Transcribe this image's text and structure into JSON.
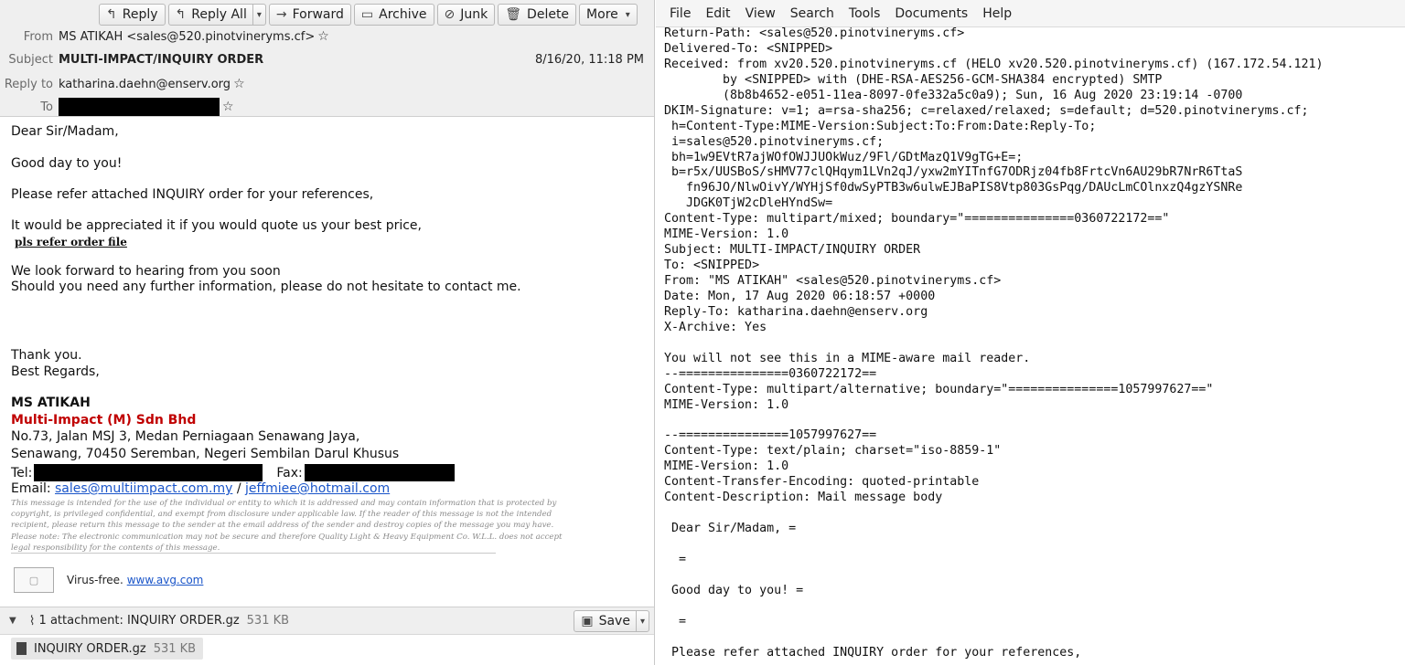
{
  "email": {
    "toolbar": {
      "reply": "Reply",
      "reply_all": "Reply All",
      "forward": "Forward",
      "archive": "Archive",
      "junk": "Junk",
      "delete": "Delete",
      "more": "More"
    },
    "header": {
      "from_label": "From",
      "from_value": "MS ATIKAH <sales@520.pinotvineryms.cf>",
      "subject_label": "Subject",
      "subject_value": "MULTI-IMPACT/INQUIRY ORDER",
      "date": "8/16/20, 11:18 PM",
      "replyto_label": "Reply to",
      "replyto_value": "katharina.daehn@enserv.org",
      "to_label": "To"
    },
    "body": {
      "greeting": "Dear Sir/Madam,",
      "line1": "Good day to you!",
      "line2": "Please refer attached INQUIRY order for your references,",
      "line3": "It would be appreciated it if you would quote us your best price,",
      "line4": "pls refer order file",
      "line5": "We look forward to hearing from you soon",
      "line6": "Should you need any further information, please do not hesitate to contact me.",
      "thanks": "Thank you.",
      "regards": "Best Regards,",
      "sig_name": "MS ATIKAH",
      "sig_company": "Multi-Impact (M) Sdn Bhd",
      "addr1": "No.73, Jalan MSJ 3, Medan Perniagaan Senawang Jaya,",
      "addr2": "Senawang, 70450 Seremban, Negeri Sembilan Darul Khusus",
      "tel_label": "Tel:",
      "fax_label": "Fax:",
      "email_label": "Email:",
      "email1": "sales@multiimpact.com.my",
      "email_sep": "/",
      "email2": "jeffmiee@hotmail.com",
      "disclaimer": [
        "This message is intended for the use of the individual or entity to which it is addressed and may contain information that is protected by",
        "copyright, is privileged confidential, and exempt from disclosure under applicable law.  If the reader of this message is not the intended",
        "recipient, please return this message to the sender at the email address of the sender and destroy copies of the message you may have.",
        "Please note: The electronic communication may not be secure and therefore Quality Light & Heavy Equipment Co. W.L.L. does not accept",
        "legal responsibility for the contents of this message."
      ],
      "avg_text": "Virus-free.",
      "avg_link": "www.avg.com"
    },
    "attachments": {
      "summary": "1 attachment: INQUIRY ORDER.gz",
      "summary_size": "531 KB",
      "save": "Save",
      "file_name": "INQUIRY ORDER.gz",
      "file_size": "531 KB"
    }
  },
  "editor": {
    "menu": [
      "File",
      "Edit",
      "View",
      "Search",
      "Tools",
      "Documents",
      "Help"
    ],
    "lines": [
      "Return-Path: <sales@520.pinotvineryms.cf>",
      "Delivered-To: <SNIPPED>",
      "Received: from xv20.520.pinotvineryms.cf (HELO xv20.520.pinotvineryms.cf) (167.172.54.121)",
      "        by <SNIPPED> with (DHE-RSA-AES256-GCM-SHA384 encrypted) SMTP",
      "        (8b8b4652-e051-11ea-8097-0fe332a5c0a9); Sun, 16 Aug 2020 23:19:14 -0700",
      "DKIM-Signature: v=1; a=rsa-sha256; c=relaxed/relaxed; s=default; d=520.pinotvineryms.cf;",
      " h=Content-Type:MIME-Version:Subject:To:From:Date:Reply-To;",
      " i=sales@520.pinotvineryms.cf;",
      " bh=1w9EVtR7ajWOfOWJJUOkWuz/9Fl/GDtMazQ1V9gTG+E=;",
      " b=r5x/UUSBoS/sHMV77clQHqym1LVn2qJ/yxw2mYITnfG7ODRjz04fb8FrtcVn6AU29bR7NrR6TtaS",
      "   fn96JO/NlwOivY/WYHjSf0dwSyPTB3w6ulwEJBaPIS8Vtp803GsPqg/DAUcLmCOlnxzQ4gzYSNRe",
      "   JDGK0TjW2cDleHYndSw=",
      "Content-Type: multipart/mixed; boundary=\"===============0360722172==\"",
      "MIME-Version: 1.0",
      "Subject: MULTI-IMPACT/INQUIRY ORDER",
      "To: <SNIPPED>",
      "From: \"MS ATIKAH\" <sales@520.pinotvineryms.cf>",
      "Date: Mon, 17 Aug 2020 06:18:57 +0000",
      "Reply-To: katharina.daehn@enserv.org",
      "X-Archive: Yes",
      "",
      "You will not see this in a MIME-aware mail reader.",
      "--===============0360722172==",
      "Content-Type: multipart/alternative; boundary=\"===============1057997627==\"",
      "MIME-Version: 1.0",
      "",
      "--===============1057997627==",
      "Content-Type: text/plain; charset=\"iso-8859-1\"",
      "MIME-Version: 1.0",
      "Content-Transfer-Encoding: quoted-printable",
      "Content-Description: Mail message body",
      "",
      " Dear Sir/Madam, =",
      "",
      "  =",
      "",
      " Good day to you! =",
      "",
      "  =",
      "",
      " Please refer attached INQUIRY order for your references,"
    ]
  }
}
